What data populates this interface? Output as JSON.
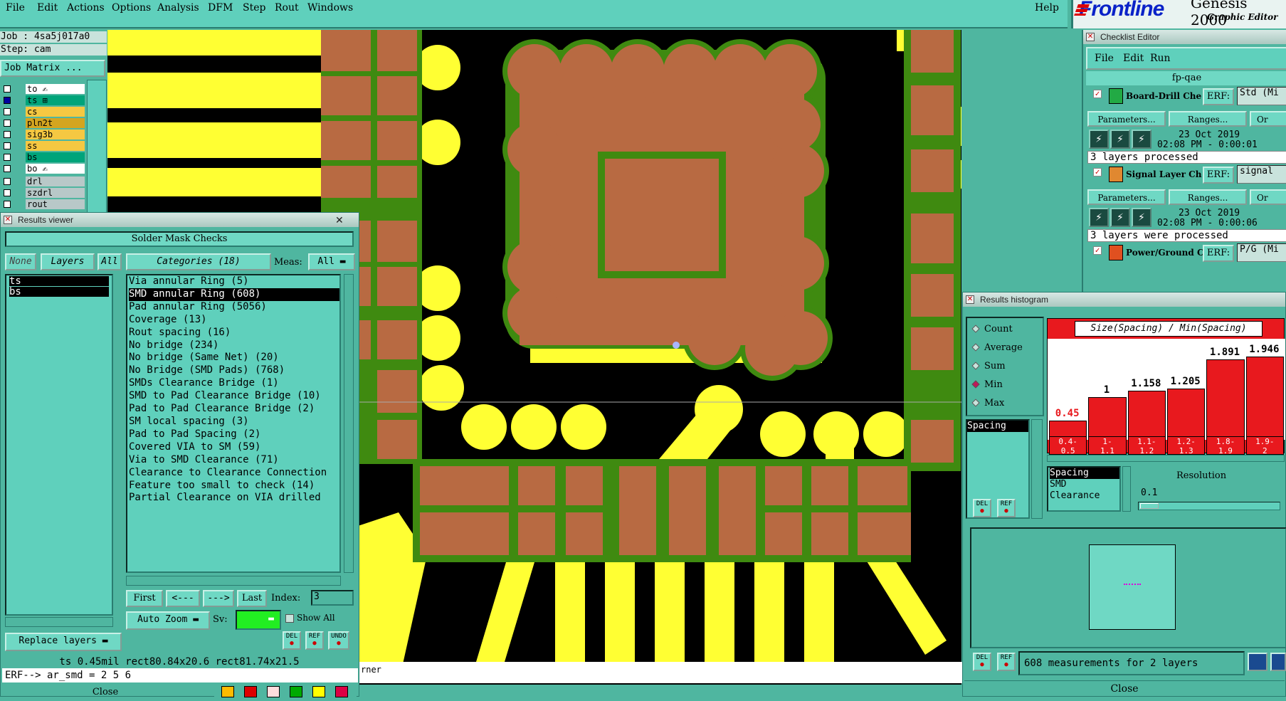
{
  "menu": [
    "File",
    "Edit",
    "Actions",
    "Options",
    "Analysis",
    "DFM",
    "Step",
    "Rout",
    "Windows"
  ],
  "help": "Help",
  "brand": {
    "logo": "Frontline",
    "product": "Genesis 2000",
    "subtitle": "Graphic Editor"
  },
  "job": {
    "job": "Job : 4sa5j017a0",
    "step": "Step: cam",
    "matrix_btn": "Job Matrix ..."
  },
  "layers": [
    {
      "name": "to",
      "color": "#ffffff",
      "on": false,
      "mark": "✍"
    },
    {
      "name": "ts",
      "color": "#00a47a",
      "on": true,
      "mark": "⊞"
    },
    {
      "name": "cs",
      "color": "#f5c842",
      "on": false,
      "mark": ""
    },
    {
      "name": "pln2t",
      "color": "#d4a520",
      "on": false,
      "mark": ""
    },
    {
      "name": "sig3b",
      "color": "#f5c842",
      "on": false,
      "mark": ""
    },
    {
      "name": "ss",
      "color": "#f5c842",
      "on": false,
      "mark": ""
    },
    {
      "name": "bs",
      "color": "#00a47a",
      "on": false,
      "mark": ""
    },
    {
      "name": "bo",
      "color": "#ffffff",
      "on": false,
      "mark": "✍"
    },
    {
      "name": "drl",
      "color": "#b8c8c8",
      "on": false,
      "mark": ""
    },
    {
      "name": "szdrl",
      "color": "#b8c8c8",
      "on": false,
      "mark": ""
    },
    {
      "name": "rout",
      "color": "#b8c8c8",
      "on": false,
      "mark": ""
    }
  ],
  "results_viewer": {
    "title": "Results viewer",
    "header": "Solder Mask Checks",
    "none_label": "None",
    "layers_label": "Layers",
    "all_label": "All",
    "categories_label": "Categories (18)",
    "meas_label": "Meas:",
    "meas_value": "All",
    "layer_list": [
      "ts",
      "bs"
    ],
    "categories": [
      "Via annular Ring (5)",
      "SMD annular Ring (608)",
      "Pad annular Ring (5056)",
      "Coverage (13)",
      "Rout spacing (16)",
      "No bridge (234)",
      "No bridge (Same Net) (20)",
      "No Bridge (SMD Pads) (768)",
      "SMDs Clearance Bridge (1)",
      "SMD to Pad Clearance Bridge (10)",
      "Pad to Pad Clearance Bridge (2)",
      "SM local spacing (3)",
      "Pad to Pad Spacing (2)",
      "Covered VIA to SM (59)",
      "Via to SMD Clearance (71)",
      "Clearance to Clearance Connection",
      "Feature too small to check (14)",
      "Partial Clearance on VIA drilled"
    ],
    "selected_category": 1,
    "first": "First",
    "prev": "<---",
    "next": "--->",
    "last": "Last",
    "index_label": "Index:",
    "index_value": "3",
    "auto_zoom": "Auto Zoom",
    "sv_label": "Sv:",
    "show_all": "Show All",
    "replace_layers": "Replace layers",
    "del": "DEL",
    "ref": "REF",
    "undo": "UNDO",
    "measure_line": "ts 0.45mil  rect80.84x20.6  rect81.74x21.5",
    "erf_line": "ERF--> ar_smd = 2 5 6",
    "close": "Close"
  },
  "canvas_status": "rner",
  "checklist": {
    "title": "Checklist Editor",
    "menu": [
      "File",
      "Edit",
      "Run"
    ],
    "name": "fp-qae",
    "erf_label": "ERF:",
    "parameters": "Parameters...",
    "ranges": "Ranges...",
    "more": "Or",
    "items": [
      {
        "name": "Board-Drill Che",
        "erf": "Std (Mi",
        "date": "23 Oct 2019",
        "time": "02:08 PM - 0:00:01",
        "status": "3 layers processed"
      },
      {
        "name": "Signal Layer Ch",
        "erf": "signal",
        "date": "23 Oct 2019",
        "time": "02:08 PM - 0:00:06",
        "status": "3 layers were processed"
      },
      {
        "name": "Power/Ground C",
        "erf": "P/G (Mi",
        "date": "",
        "time": "",
        "status": ""
      }
    ]
  },
  "histogram": {
    "title": "Results histogram",
    "modes": [
      "Count",
      "Average",
      "Sum",
      "Min",
      "Max"
    ],
    "selected_mode": "Min",
    "chart_title": "Size(Spacing) / Min(Spacing)",
    "measure_list": [
      "Spacing"
    ],
    "bottom_list": [
      "Spacing",
      "SMD",
      "Clearance"
    ],
    "resolution_label": "Resolution",
    "resolution_value": "0.1",
    "footer": "608 measurements for 2 layers",
    "close": "Close"
  },
  "chart_data": {
    "type": "bar",
    "title": "Size(Spacing) / Min(Spacing)",
    "categories": [
      "0.4-0.5",
      "1-1.1",
      "1.1-1.2",
      "1.2-1.3",
      "1.8-1.9",
      "1.9-2"
    ],
    "values": [
      0.45,
      1,
      1.158,
      1.205,
      1.891,
      1.946
    ],
    "data_labels": [
      "0.45",
      "1",
      "1.158",
      "1.205",
      "1.891",
      "1.946"
    ],
    "range_labels": [
      [
        "0.4-",
        "0.5"
      ],
      [
        "1-",
        "1.1"
      ],
      [
        "1.1-",
        "1.2"
      ],
      [
        "1.2-",
        "1.3"
      ],
      [
        "1.8-",
        "1.9"
      ],
      [
        "1.9-",
        "2"
      ]
    ],
    "first_label_color": "#e8191e",
    "bar_color": "#e8191e"
  },
  "colors": {
    "pad": "#b86a42",
    "mask": "#3f8a10",
    "copper": "#ffff33",
    "ui": "#4fb6a0"
  }
}
